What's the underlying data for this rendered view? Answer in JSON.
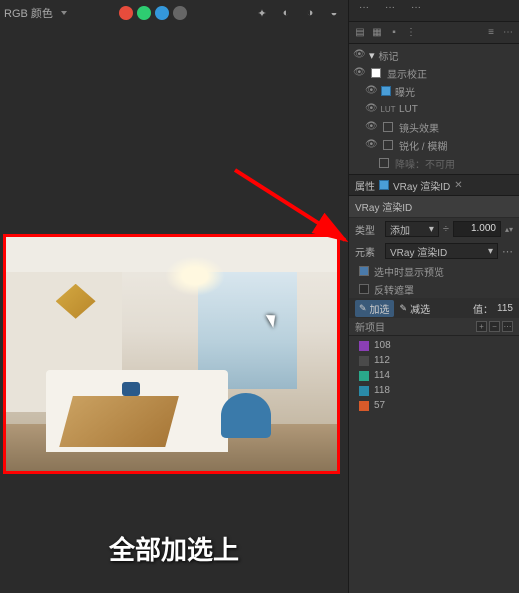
{
  "toolbar": {
    "color_label": "RGB 颜色"
  },
  "layers": {
    "root": "标记",
    "correction": "显示校正",
    "exposure": "曝光",
    "lut": "LUT",
    "lens": "镜头效果",
    "sharpen": "锐化 / 模糊",
    "noise": "降噪：不可用"
  },
  "props": {
    "header_label": "属性",
    "vray_tab": "VRay 渲染ID",
    "vray_title": "VRay 渲染ID",
    "type_label": "类型",
    "type_value": "添加",
    "type_num": "1.000",
    "element_label": "元素",
    "element_value": "VRay 渲染ID",
    "preview": "选中时显示预览",
    "invert": "反转遮罩",
    "add": "加选",
    "subtract": "减选",
    "val_label": "值：",
    "val": "115"
  },
  "list": {
    "header": "新项目",
    "items": [
      {
        "color": "#8a3fb5",
        "label": "108"
      },
      {
        "color": "#4a4a4a",
        "label": "112"
      },
      {
        "color": "#2aa88a",
        "label": "114"
      },
      {
        "color": "#2a8aa8",
        "label": "118"
      },
      {
        "color": "#d85a2a",
        "label": "57"
      }
    ]
  },
  "caption": "全部加选上"
}
